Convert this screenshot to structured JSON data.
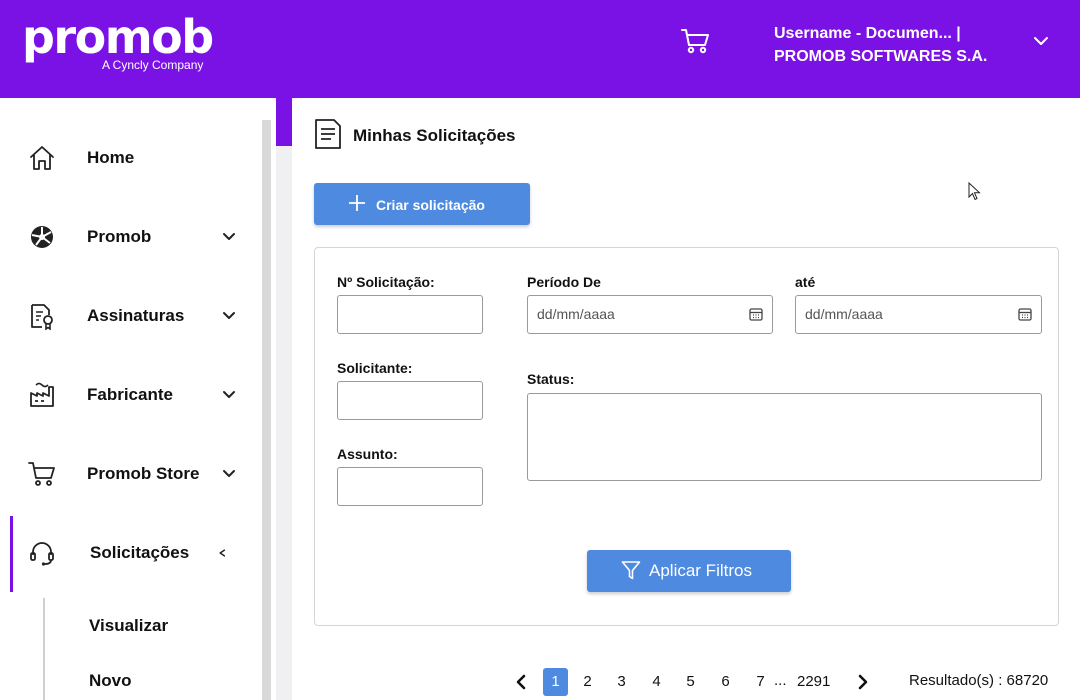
{
  "header": {
    "logo": "promob",
    "logo_sub": "A Cyncly Company",
    "user_line1": "Username - Documen... |",
    "user_line2": "PROMOB SOFTWARES S.A."
  },
  "sidebar": {
    "items": [
      {
        "label": "Home",
        "icon": "home-icon"
      },
      {
        "label": "Promob",
        "icon": "promob-icon"
      },
      {
        "label": "Assinaturas",
        "icon": "certificate-icon"
      },
      {
        "label": "Fabricante",
        "icon": "factory-icon"
      },
      {
        "label": "Promob Store",
        "icon": "cart-icon"
      },
      {
        "label": "Solicitações",
        "icon": "headset-icon"
      }
    ],
    "subitems": [
      {
        "label": "Visualizar"
      },
      {
        "label": "Novo"
      }
    ]
  },
  "main": {
    "title": "Minhas Solicitações",
    "create_button": "Criar solicitação",
    "filters": {
      "numero_label": "Nº Solicitação:",
      "periodo_de_label": "Período De",
      "ate_label": "até",
      "date_placeholder": "dd/mm/aaaa",
      "solicitante_label": "Solicitante:",
      "status_label": "Status:",
      "assunto_label": "Assunto:",
      "apply_button": "Aplicar Filtros"
    },
    "pagination": {
      "pages": [
        "1",
        "2",
        "3",
        "4",
        "5",
        "6",
        "7"
      ],
      "current_page": "1",
      "ellipsis": "...",
      "last_page": "2291",
      "result_text": "Resultado(s) : 68720"
    }
  },
  "colors": {
    "brand_purple": "#7a12e6",
    "button_blue": "#4e8ae0"
  }
}
